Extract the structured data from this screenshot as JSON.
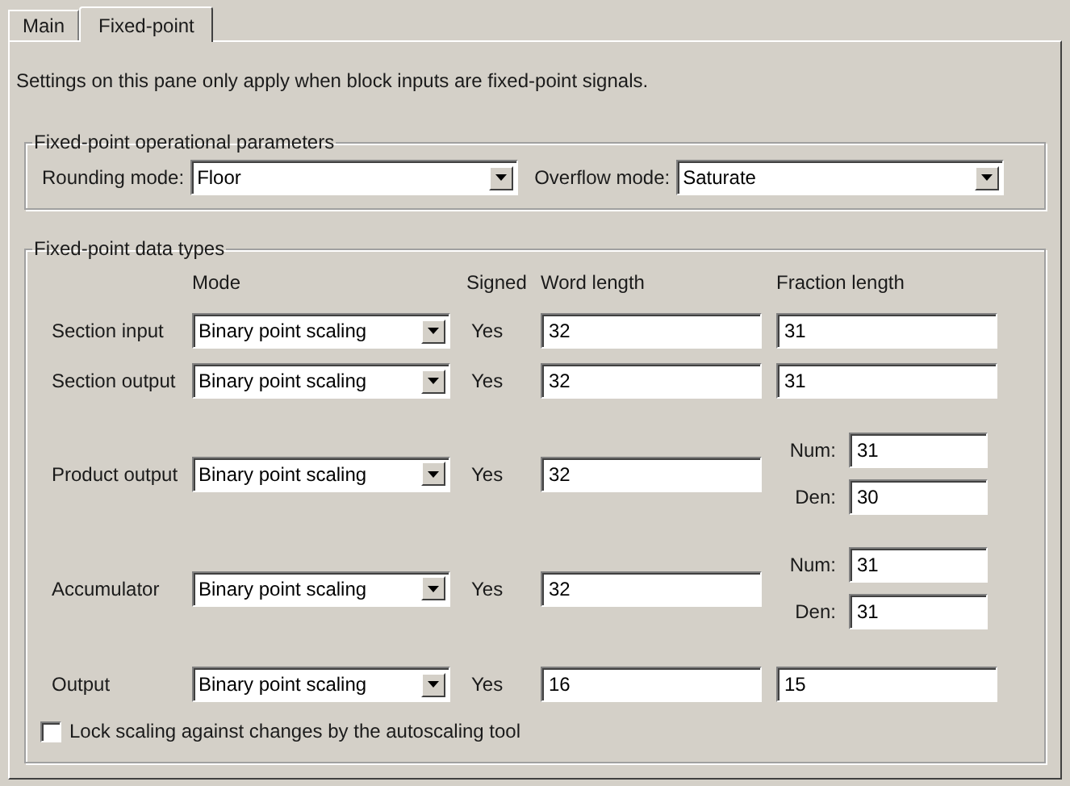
{
  "tabs": [
    {
      "label": "Main",
      "selected": false
    },
    {
      "label": "Fixed-point",
      "selected": true
    }
  ],
  "description": "Settings on this pane only apply when block inputs are fixed-point signals.",
  "operational_parameters": {
    "title": "Fixed-point operational parameters",
    "rounding_mode": {
      "label": "Rounding mode:",
      "value": "Floor"
    },
    "overflow_mode": {
      "label": "Overflow mode:",
      "value": "Saturate"
    }
  },
  "data_types": {
    "title": "Fixed-point data types",
    "columns": [
      "Mode",
      "Signed",
      "Word length",
      "Fraction length"
    ],
    "rows": [
      {
        "kind": "simple",
        "label": "Section input",
        "mode": "Binary point scaling",
        "signed": "Yes",
        "word_length": "32",
        "fraction_length": "31"
      },
      {
        "kind": "simple",
        "label": "Section output",
        "mode": "Binary point scaling",
        "signed": "Yes",
        "word_length": "32",
        "fraction_length": "31"
      },
      {
        "kind": "num_den",
        "label": "Product output",
        "mode": "Binary point scaling",
        "signed": "Yes",
        "word_length": "32",
        "num_label": "Num:",
        "num": "31",
        "den_label": "Den:",
        "den": "30"
      },
      {
        "kind": "num_den",
        "label": "Accumulator",
        "mode": "Binary point scaling",
        "signed": "Yes",
        "word_length": "32",
        "num_label": "Num:",
        "num": "31",
        "den_label": "Den:",
        "den": "31"
      },
      {
        "kind": "simple",
        "label": "Output",
        "mode": "Binary point scaling",
        "signed": "Yes",
        "word_length": "16",
        "fraction_length": "15"
      }
    ],
    "lock_scaling": {
      "label": "Lock scaling against changes by the autoscaling tool",
      "checked": false
    }
  }
}
